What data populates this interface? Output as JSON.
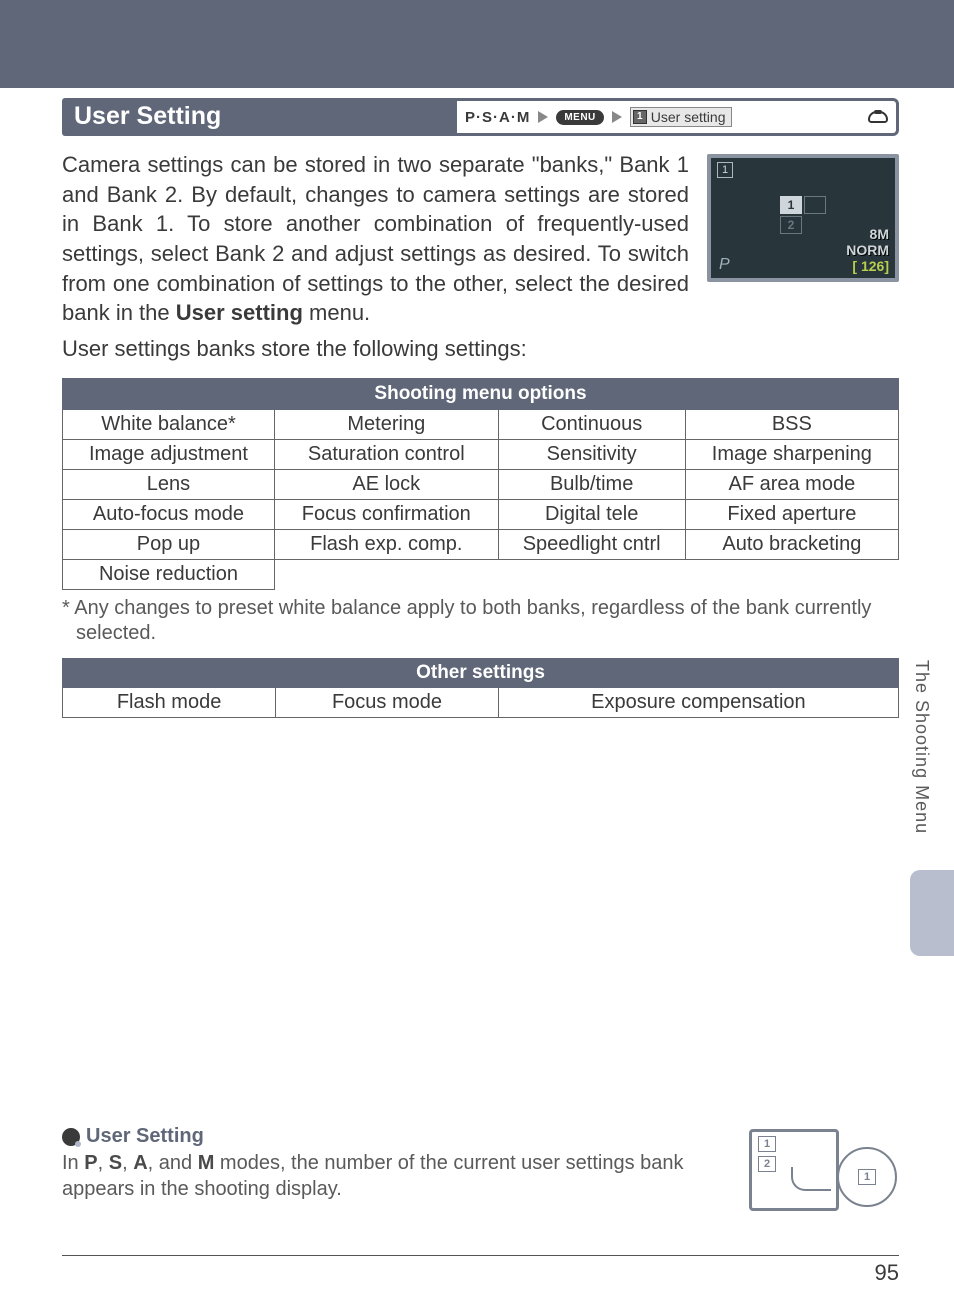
{
  "header": {
    "title": "User Setting",
    "mode_letters": "P·S·A·M",
    "menu_pill": "MENU",
    "breadcrumb_label": "User setting",
    "breadcrumb_bank": "1"
  },
  "body": {
    "paragraph_before_bold": "Camera settings can be stored in two separate \"banks,\" Bank 1 and Bank 2.  By default, changes to camera settings are stored in Bank 1.  To store another combination of frequently-used settings, select Bank 2 and adjust settings as desired.  To switch from one combination of settings to the other, select the desired bank in the ",
    "paragraph_bold": "User setting",
    "paragraph_after_bold": " menu.",
    "sub_paragraph": "User settings banks store the following settings:"
  },
  "lcd": {
    "topleft": "1",
    "sel": "1",
    "two": "2",
    "bl": "P",
    "size": "8M",
    "norm": "NORM",
    "count": "[  126]"
  },
  "table1": {
    "header": "Shooting menu options",
    "rows": [
      [
        "White balance*",
        "Metering",
        "Continuous",
        "BSS"
      ],
      [
        "Image adjustment",
        "Saturation control",
        "Sensitivity",
        "Image sharpening"
      ],
      [
        "Lens",
        "AE lock",
        "Bulb/time",
        "AF area mode"
      ],
      [
        "Auto-focus mode",
        "Focus confirmation",
        "Digital tele",
        "Fixed aperture"
      ],
      [
        "Pop up",
        "Flash exp. comp.",
        "Speedlight cntrl",
        "Auto bracketing"
      ],
      [
        "Noise reduction",
        "",
        "",
        ""
      ]
    ]
  },
  "footnote": "* Any changes to preset white balance apply to both banks, regardless of the bank currently selected.",
  "table2": {
    "header": "Other settings",
    "cells": [
      "Flash mode",
      "Focus mode",
      "Exposure compensation"
    ]
  },
  "side_tab": "The Shooting Menu",
  "tip": {
    "title": "User Setting",
    "before_bold": "In ",
    "b1": "P",
    "sep": ", ",
    "b2": "S",
    "b3": "A",
    "and": ", and ",
    "b4": "M",
    "after_bold": " modes, the number of the current user settings bank appears in the shooting display.",
    "ill_b1": "1",
    "ill_b2": "2",
    "ill_inner": "1"
  },
  "page_number": "95"
}
